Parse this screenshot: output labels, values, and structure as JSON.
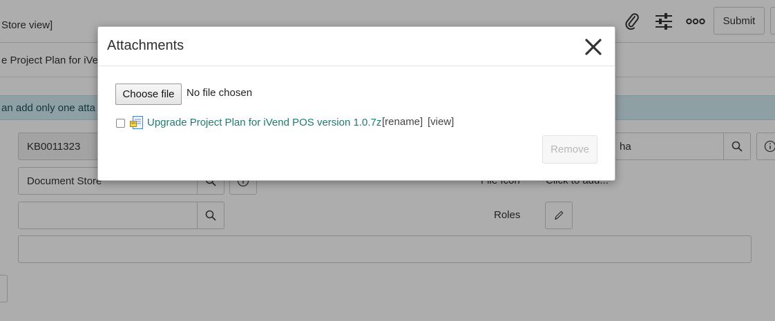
{
  "page": {
    "header": {
      "title_fragment": "Store view]",
      "submit_label": "Submit",
      "icons": [
        "paperclip-icon",
        "sliders-icon",
        "more-icon"
      ]
    },
    "subtitle_fragment": "e Project Plan for iVe",
    "info_fragment": "an add only one atta",
    "form": {
      "number_value": "KB0011323",
      "source_value": "Document Store",
      "author_fragment": "ha",
      "file_icon_label": "File Icon",
      "file_icon_value": "Click to add...",
      "roles_label": "Roles"
    }
  },
  "modal": {
    "title": "Attachments",
    "choose_file_label": "Choose file",
    "file_status": "No file chosen",
    "attachment": {
      "name": "Upgrade Project Plan for iVend POS version 1.0.7z",
      "rename_label": "[rename]",
      "view_label": "[view]"
    },
    "remove_label": "Remove"
  },
  "colors": {
    "link": "#1f7a74",
    "info_bar": "#d3ecf2",
    "overlay": "rgba(0,0,0,0.32)"
  }
}
